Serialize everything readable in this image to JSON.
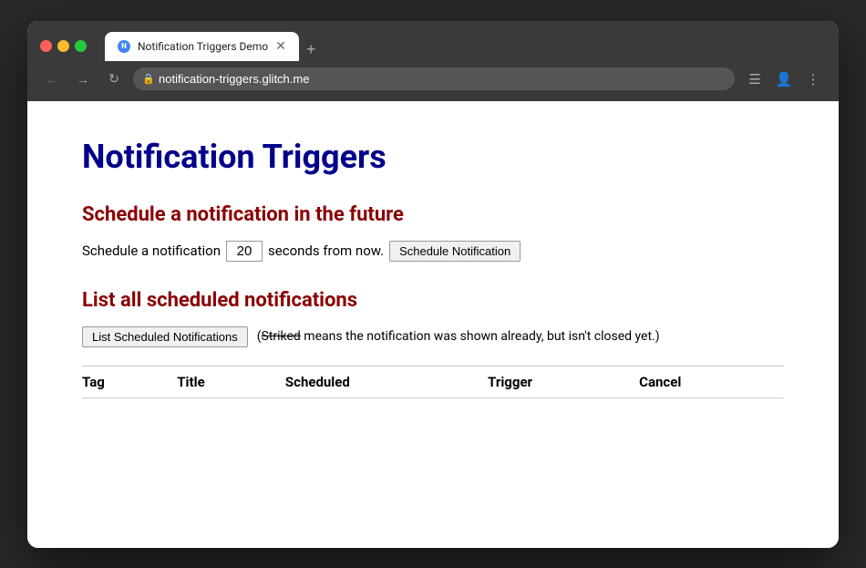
{
  "browser": {
    "tab_title": "Notification Triggers Demo",
    "tab_close": "✕",
    "new_tab": "+",
    "url": "notification-triggers.glitch.me",
    "nav_back": "←",
    "nav_forward": "→",
    "nav_reload": "↻",
    "action_list": "☰",
    "action_profile": "👤",
    "action_more": "⋮"
  },
  "page": {
    "title": "Notification Triggers",
    "schedule_section_heading": "Schedule a notification in the future",
    "schedule_label_before": "Schedule a notification",
    "schedule_seconds_value": "20",
    "schedule_label_after": "seconds from now.",
    "schedule_button": "Schedule Notification",
    "list_section_heading": "List all scheduled notifications",
    "list_button": "List Scheduled Notifications",
    "strikethrough_word": "Striked",
    "note_text": " means the notification was shown already, but isn't closed yet.)",
    "open_paren": "(",
    "table_headers": [
      "Tag",
      "Title",
      "Scheduled",
      "Trigger",
      "Cancel"
    ]
  }
}
